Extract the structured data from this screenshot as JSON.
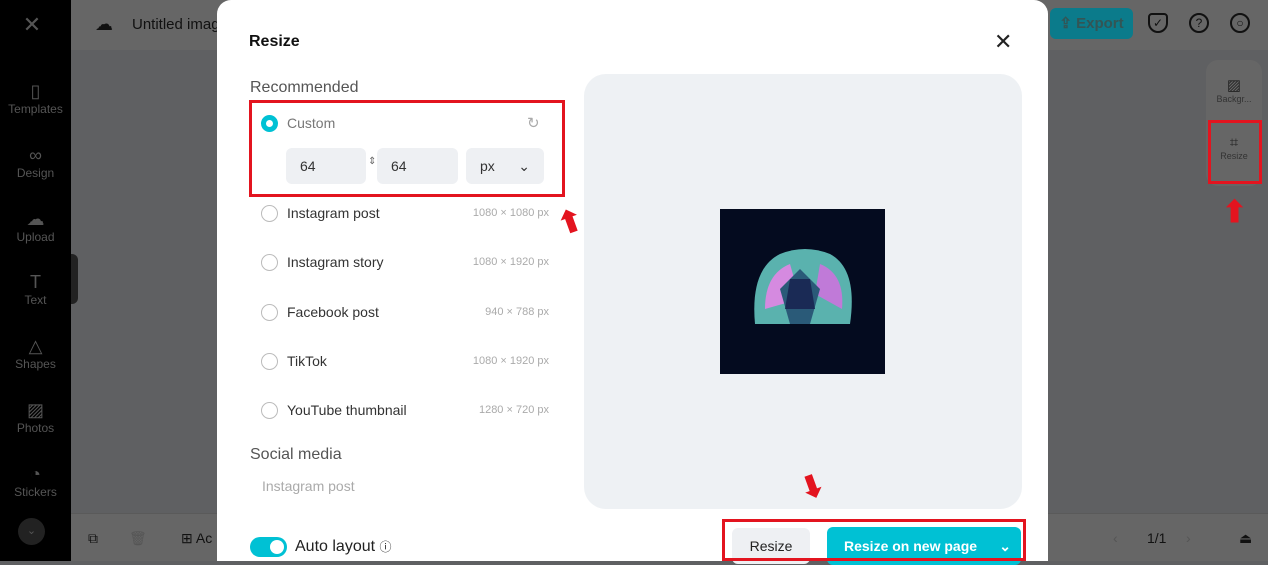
{
  "app": {
    "title": "Untitled image",
    "export_label": "Export"
  },
  "sidebar": {
    "items": [
      {
        "label": "Templates",
        "icon": "templates-icon"
      },
      {
        "label": "Design",
        "icon": "design-icon"
      },
      {
        "label": "Upload",
        "icon": "upload-icon"
      },
      {
        "label": "Text",
        "icon": "text-icon"
      },
      {
        "label": "Shapes",
        "icon": "shapes-icon"
      },
      {
        "label": "Photos",
        "icon": "photos-icon"
      },
      {
        "label": "Stickers",
        "icon": "stickers-icon"
      }
    ]
  },
  "right_panel": {
    "items": [
      {
        "label": "Backgr..."
      },
      {
        "label": "Resize"
      }
    ]
  },
  "bottom": {
    "add_label": "Ac",
    "page": "1/1"
  },
  "modal": {
    "title": "Resize",
    "recommended": "Recommended",
    "custom": {
      "label": "Custom",
      "width": "64",
      "height": "64",
      "unit": "px"
    },
    "presets": [
      {
        "label": "Instagram post",
        "size": "1080 × 1080 px"
      },
      {
        "label": "Instagram story",
        "size": "1080 × 1920 px"
      },
      {
        "label": "Facebook post",
        "size": "940 × 788 px"
      },
      {
        "label": "TikTok",
        "size": "1080 × 1920 px"
      },
      {
        "label": "YouTube thumbnail",
        "size": "1280 × 720 px"
      }
    ],
    "social_media": "Social media",
    "social_first": "Instagram post",
    "auto_layout": {
      "label": "Auto layout",
      "on": true
    },
    "resize_label": "Resize",
    "resize_new_label": "Resize on new page"
  },
  "colors": {
    "accent": "#00c1d4",
    "highlight": "#e3141f"
  }
}
